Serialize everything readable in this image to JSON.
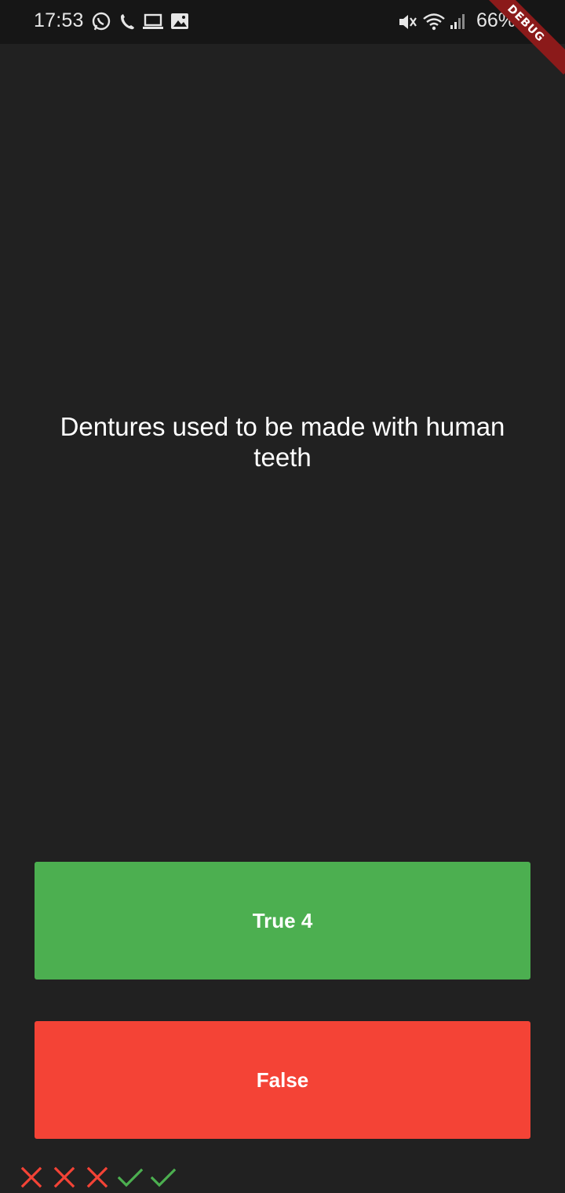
{
  "status_bar": {
    "time": "17:53",
    "battery": "66%",
    "icons": [
      "whatsapp-icon",
      "phone-icon",
      "laptop-icon",
      "image-icon",
      "mute-icon",
      "wifi-icon",
      "signal-icon",
      "battery-icon"
    ]
  },
  "debug_banner": "DEBUG",
  "quiz": {
    "question": "Dentures used to be made with human teeth",
    "true_label": "True 4",
    "false_label": "False",
    "score": [
      "wrong",
      "wrong",
      "wrong",
      "correct",
      "correct"
    ]
  },
  "colors": {
    "background": "#212121",
    "true_button": "#4caf50",
    "false_button": "#f44336",
    "check_mark": "#4caf50",
    "cross_mark": "#f44336"
  }
}
